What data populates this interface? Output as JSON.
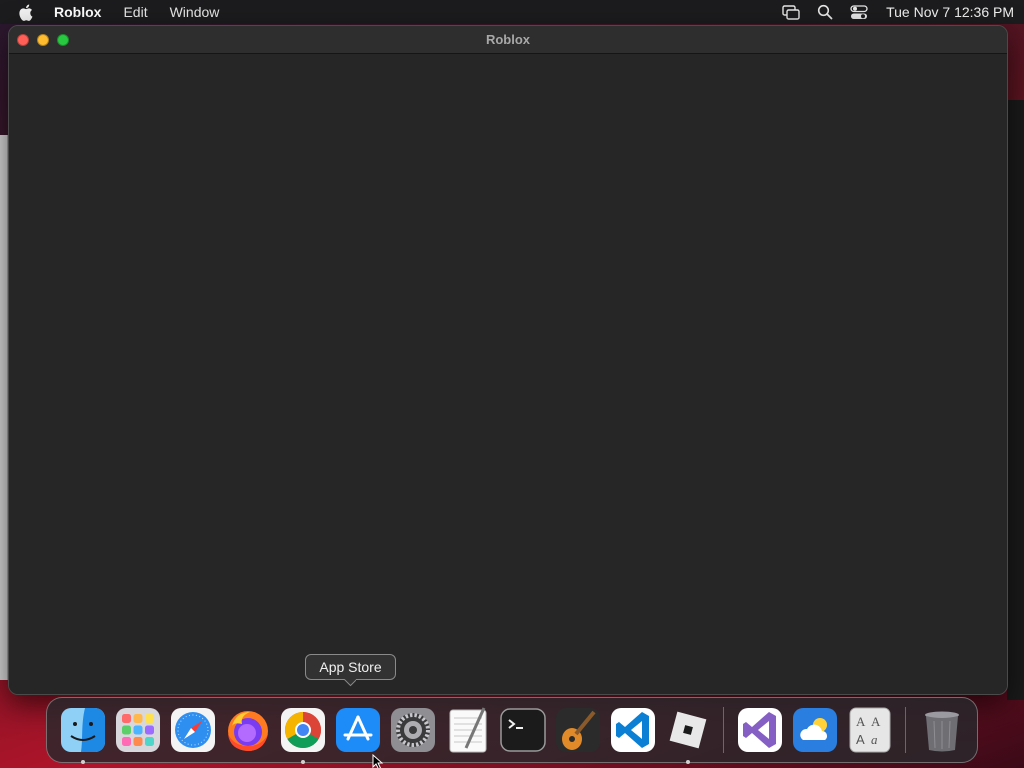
{
  "menubar": {
    "app_name": "Roblox",
    "menus": [
      "Edit",
      "Window"
    ],
    "clock": "Tue Nov 7  12:36 PM",
    "status_icons": [
      "screen-mirroring-icon",
      "spotlight-search-icon",
      "control-center-icon"
    ]
  },
  "window": {
    "title": "Roblox",
    "controls": [
      "close",
      "minimize",
      "zoom"
    ]
  },
  "tooltip": {
    "text": "App Store"
  },
  "dock": {
    "items": [
      {
        "name": "Finder",
        "icon": "finder-icon",
        "running": true
      },
      {
        "name": "Launchpad",
        "icon": "launchpad-icon",
        "running": false
      },
      {
        "name": "Safari",
        "icon": "safari-icon",
        "running": false
      },
      {
        "name": "Firefox",
        "icon": "firefox-icon",
        "running": false
      },
      {
        "name": "Google Chrome",
        "icon": "chrome-icon",
        "running": true
      },
      {
        "name": "App Store",
        "icon": "app-store-icon",
        "running": false
      },
      {
        "name": "System Settings",
        "icon": "system-settings-icon",
        "running": false
      },
      {
        "name": "TextEdit",
        "icon": "textedit-icon",
        "running": false
      },
      {
        "name": "Terminal",
        "icon": "terminal-icon",
        "running": false
      },
      {
        "name": "GarageBand",
        "icon": "garageband-icon",
        "running": false
      },
      {
        "name": "Visual Studio Code",
        "icon": "vscode-icon",
        "running": false
      },
      {
        "name": "Roblox",
        "icon": "roblox-icon",
        "running": true
      },
      {
        "name": "Visual Studio",
        "icon": "visual-studio-icon",
        "running": false
      },
      {
        "name": "Weather",
        "icon": "weather-icon",
        "running": false
      },
      {
        "name": "Font Book",
        "icon": "font-book-icon",
        "running": false
      },
      {
        "name": "Trash",
        "icon": "trash-icon",
        "running": false
      }
    ]
  },
  "colors": {
    "menubar_bg": "#1c1c1e",
    "window_bg": "#262626",
    "close": "#ff5f57",
    "minimize": "#febc2e",
    "zoom": "#28c840"
  }
}
